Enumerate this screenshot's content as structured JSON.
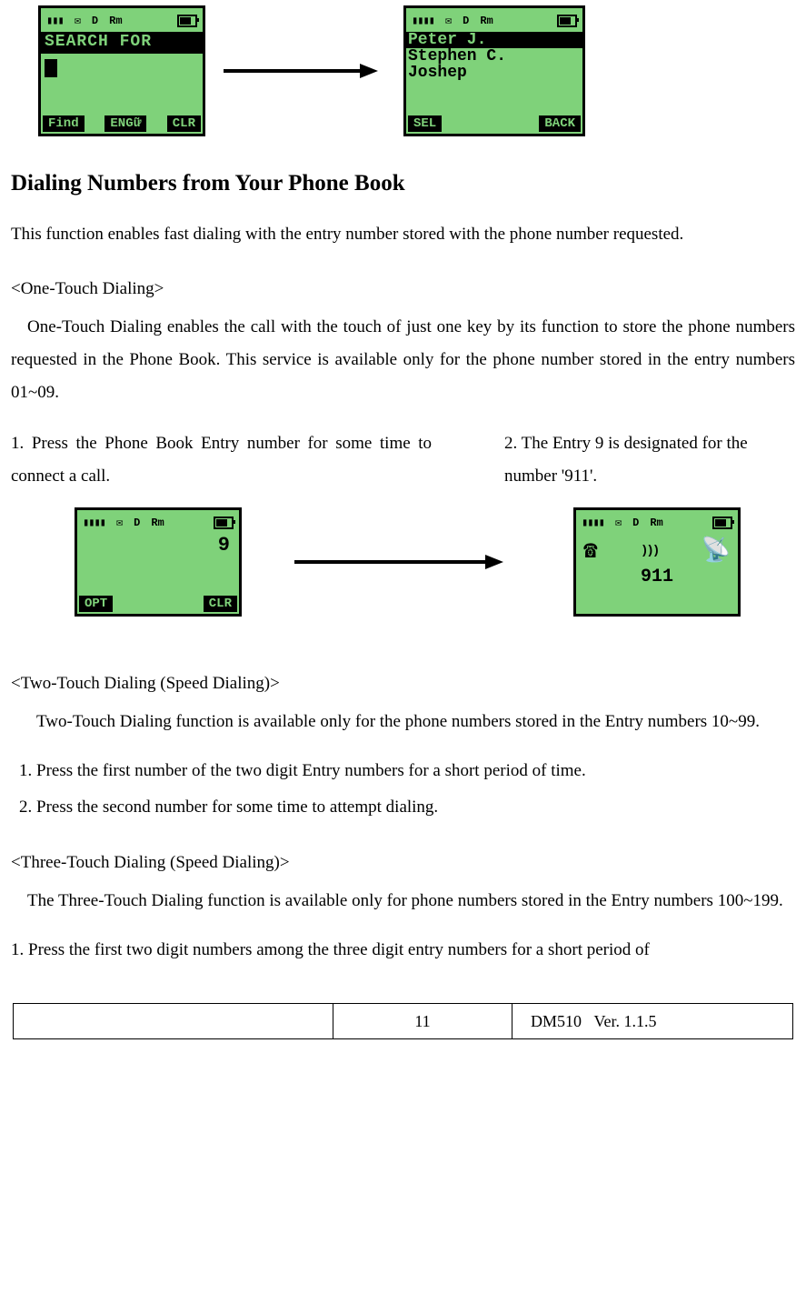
{
  "screens": {
    "searchFor": {
      "title": "SEARCH FOR",
      "softLeft": "Find",
      "softMid": "ENGữ",
      "softRight": "CLR",
      "statusIcons": {
        "signal": "T.ill",
        "env": "✉",
        "d": "D",
        "rm": "Rm",
        "batt": "batt"
      }
    },
    "contacts": {
      "items": [
        "Peter J.",
        "Stephen C.",
        "Joshep"
      ],
      "softLeft": "SEL",
      "softRight": "BACK"
    },
    "entry9": {
      "digit": "9",
      "softLeft": "OPT",
      "softRight": "CLR"
    },
    "dial911": {
      "number": "911"
    }
  },
  "headings": {
    "main": "Dialing Numbers from Your Phone Book",
    "oneTouch": "<One-Touch Dialing>",
    "twoTouch": "<Two-Touch Dialing (Speed Dialing)>",
    "threeTouch": "<Three-Touch Dialing (Speed Dialing)>"
  },
  "paragraphs": {
    "intro": "This function enables fast dialing with the entry number stored with the phone number requested.",
    "oneTouch": "One-Touch Dialing enables the call with the touch of just one key by its function to store the phone numbers requested in the Phone Book. This service is available only for the phone number stored in the entry numbers 01~09.",
    "step1": "1. Press the Phone Book Entry number for some time to connect a call.",
    "step2": "2. The Entry 9 is designated for the number '911'.",
    "twoTouch": "Two-Touch Dialing function is available only for the phone numbers stored in the Entry numbers 10~99.",
    "twoStep1": "Press the first number of the two digit Entry numbers for a short period of time.",
    "twoStep2": "Press the second number for some time to attempt dialing.",
    "threeTouch": "The Three-Touch Dialing function is available only for phone numbers stored in the Entry numbers 100~199.",
    "threeStep1": "1. Press the first two digit numbers among the three digit entry numbers for a short period of"
  },
  "footer": {
    "page": "11",
    "model": "DM510",
    "version": "Ver. 1.1.5"
  }
}
